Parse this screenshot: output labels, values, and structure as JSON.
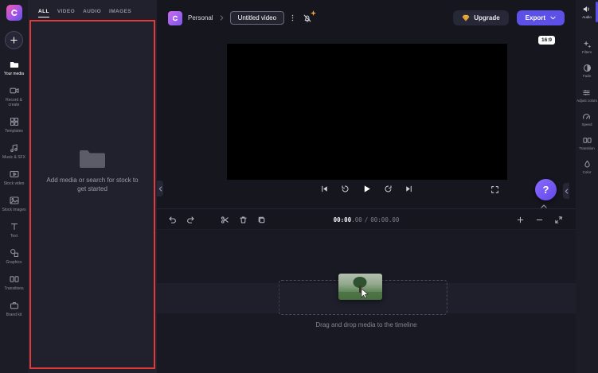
{
  "header": {
    "workspace": "Personal",
    "project_title": "Untitled video",
    "upgrade_label": "Upgrade",
    "export_label": "Export"
  },
  "left_rail": {
    "items": [
      {
        "label": "Your media"
      },
      {
        "label": "Record & create"
      },
      {
        "label": "Templates"
      },
      {
        "label": "Music & SFX"
      },
      {
        "label": "Stock video"
      },
      {
        "label": "Stock images"
      },
      {
        "label": "Text"
      },
      {
        "label": "Graphics"
      },
      {
        "label": "Transitions"
      },
      {
        "label": "Brand kit"
      }
    ]
  },
  "media_panel": {
    "tabs": [
      "ALL",
      "VIDEO",
      "AUDIO",
      "IMAGES"
    ],
    "active_tab": "ALL",
    "empty_message": "Add media or search for stock to get started"
  },
  "preview": {
    "aspect": "16:9"
  },
  "timecode": {
    "current": "00:00",
    "current_ms": ".00",
    "separator": "/",
    "total": "00:00",
    "total_ms": ".00"
  },
  "timeline": {
    "drop_hint": "Drag and drop media to the timeline"
  },
  "right_rail": {
    "items": [
      "Audio",
      "Filters",
      "Fade",
      "Adjust colors",
      "Speed",
      "Transition",
      "Color"
    ]
  },
  "help": {
    "label": "?"
  },
  "colors": {
    "accent": "#5c50e6",
    "annotation_red": "#e03a3a",
    "upgrade_gem": "#f3b23e",
    "preview_bg": "#000000"
  }
}
